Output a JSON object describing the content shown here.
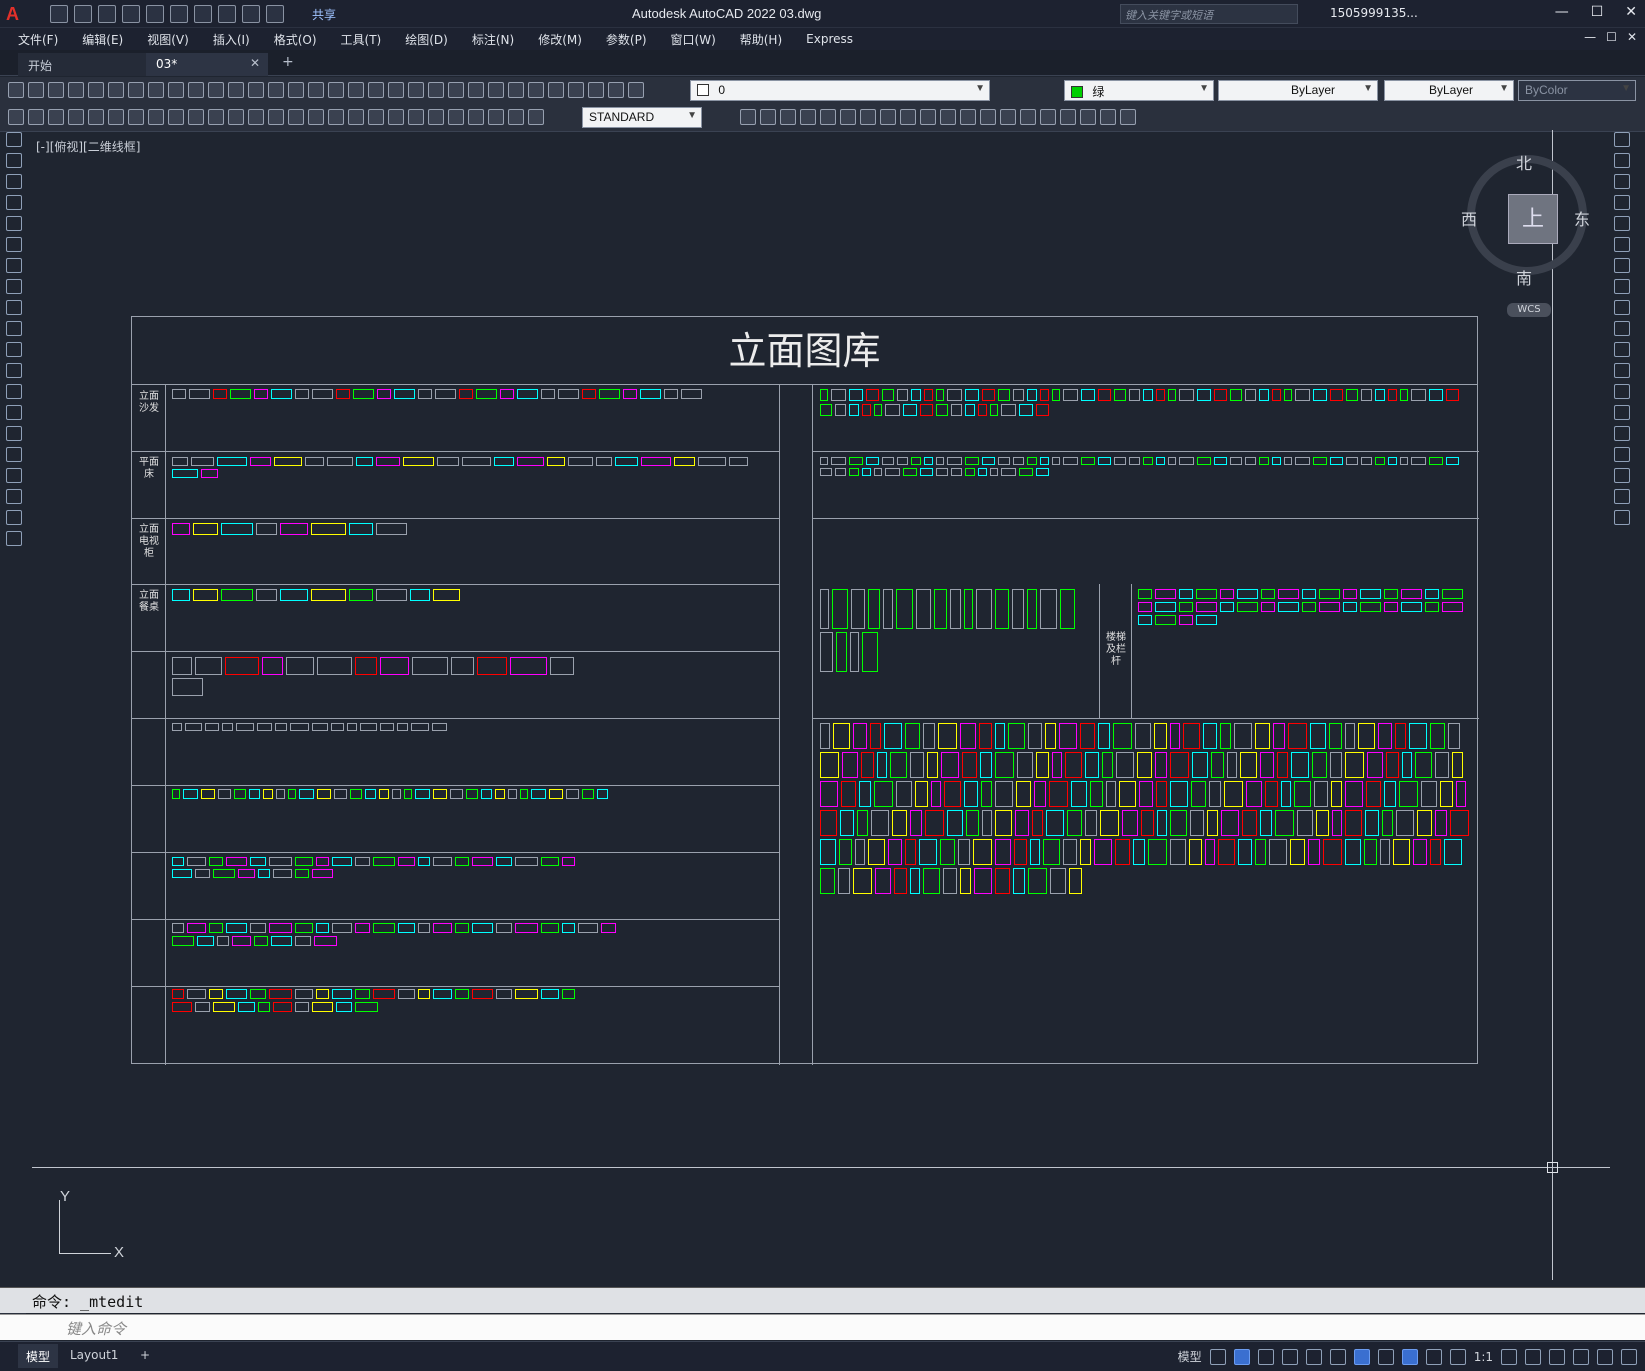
{
  "titlebar": {
    "logo": "A",
    "share": "共享",
    "title": "Autodesk AutoCAD 2022    03.dwg",
    "search_placeholder": "键入关键字或短语",
    "user": "1505999135...",
    "min": "—",
    "max": "☐",
    "close": "✕"
  },
  "menu": [
    "文件(F)",
    "编辑(E)",
    "视图(V)",
    "插入(I)",
    "格式(O)",
    "工具(T)",
    "绘图(D)",
    "标注(N)",
    "修改(M)",
    "参数(P)",
    "窗口(W)",
    "帮助(H)",
    "Express"
  ],
  "tabs": {
    "start": "开始",
    "active": "03*",
    "close": "✕",
    "add": "+"
  },
  "toolbar": {
    "layer_value": "0",
    "color_value": "绿",
    "linetype_value": "ByLayer",
    "lineweight_value": "ByLayer",
    "plotstyle_value": "ByColor",
    "textstyle_value": "STANDARD"
  },
  "viewport": {
    "label": "[-][俯视][二维线框]"
  },
  "drawing": {
    "title": "立面图库",
    "row_labels_left": [
      "立面沙发",
      "平面床",
      "立面电视柜",
      "立面餐桌",
      "",
      "",
      "",
      "",
      "",
      ""
    ],
    "row_label_stair": "楼梯及栏杆"
  },
  "viewcube": {
    "north": "北",
    "south": "南",
    "east": "东",
    "west": "西",
    "face": "上",
    "wcs": "WCS"
  },
  "ucs": {
    "x": "X",
    "y": "Y"
  },
  "command": {
    "history": "命令:  _mtedit",
    "placeholder": "键入命令"
  },
  "status": {
    "model": "模型",
    "layout": "Layout1",
    "add": "+",
    "model_btn": "模型",
    "scale": "1:1"
  },
  "colors": {
    "accent": "#3a6fd0",
    "green": "#00ff00",
    "cyan": "#00ffff",
    "magenta": "#ff00ff",
    "yellow": "#ffff00",
    "red": "#ff0000",
    "gray": "#9aa1ad"
  }
}
